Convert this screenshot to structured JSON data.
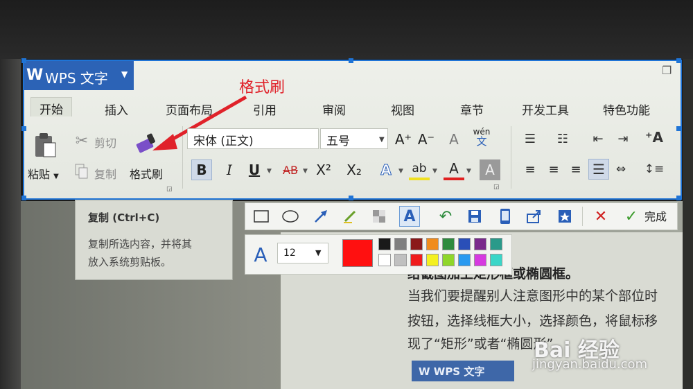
{
  "app": {
    "logo": "W",
    "title": "WPS 文字"
  },
  "annotation": {
    "label": "格式刷",
    "color": "#e0222a"
  },
  "tabs": [
    {
      "label": "开始",
      "active": true
    },
    {
      "label": "插入"
    },
    {
      "label": "页面布局"
    },
    {
      "label": "引用"
    },
    {
      "label": "审阅"
    },
    {
      "label": "视图"
    },
    {
      "label": "章节"
    },
    {
      "label": "开发工具"
    },
    {
      "label": "特色功能"
    }
  ],
  "clipboard": {
    "paste": "粘贴",
    "cut": "剪切",
    "copy": "复制",
    "format_painter": "格式刷"
  },
  "font": {
    "name": "宋体 (正文)",
    "size": "五号",
    "bold": "B",
    "italic": "I",
    "underline": "U",
    "strike": "AB",
    "superscript": "X²",
    "subscript": "X₂",
    "text_effect": "A",
    "highlight": "ab",
    "font_color": "A",
    "char_shading": "A",
    "grow": "A⁺",
    "shrink": "A⁻",
    "clear": "A",
    "phonetic_top": "wén",
    "phonetic_bottom": "文"
  },
  "tooltip": {
    "title": "复制 (Ctrl+C)",
    "line1": "复制所选内容，并将其",
    "line2": "放入系统剪贴板。"
  },
  "capture_toolbar": {
    "done": "完成",
    "font_icon": "A",
    "size": "12",
    "current_color": "#ff1010",
    "swatches_row1": [
      "#1a1a1a",
      "#7f7f7f",
      "#8b1a1a",
      "#f08c1c",
      "#2e8b3e",
      "#2a4fb8",
      "#7a2a8c",
      "#2a9a8a"
    ],
    "swatches_row2": [
      "#ffffff",
      "#c0c0c0",
      "#f01c1c",
      "#f4f020",
      "#8fd62a",
      "#2a9af0",
      "#d63ae0",
      "#3ad6c8"
    ]
  },
  "document": {
    "heading": "给截图加上矩形框或椭圆框。",
    "line1": "当我们要提醒别人注意图形中的某个部位时",
    "line2": "按钮，选择线框大小，选择颜色，将鼠标移",
    "line3": "现了“矩形”或者“椭圆形”",
    "mini_title": "W WPS 文字"
  },
  "watermark": {
    "brand": "Bai 经验",
    "url": "jingyan.baidu.com"
  }
}
